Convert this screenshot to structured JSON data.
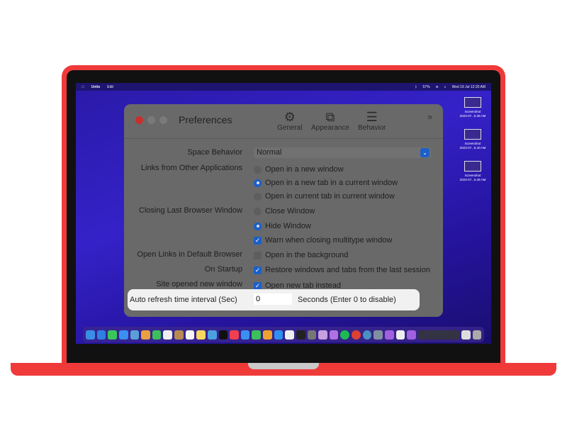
{
  "menubar": {
    "app": "Unite",
    "menu": "Edit",
    "battery": "57%",
    "datetime": "Wed 19 Jul 12:20 AM"
  },
  "desktop_icons": [
    {
      "line1": "Screenshot",
      "line2": "2023-07...5.38 AM"
    },
    {
      "line1": "Screenshot",
      "line2": "2023-07...5.40 AM"
    },
    {
      "line1": "Screenshot",
      "line2": "2023-07...5.45 AM"
    }
  ],
  "window": {
    "title": "Preferences",
    "toolbar": [
      {
        "label": "General",
        "icon": "gear-icon"
      },
      {
        "label": "Appearance",
        "icon": "appearance-icon"
      },
      {
        "label": "Behavior",
        "icon": "sliders-icon"
      }
    ],
    "space_behavior": {
      "label": "Space Behavior",
      "value": "Normal"
    },
    "links_other_apps": {
      "label": "Links from Other Applications",
      "options": [
        "Open in a new window",
        "Open in a new tab in a current window",
        "Open in current tab in current window"
      ],
      "selected": 1
    },
    "closing_last": {
      "label": "Closing Last Browser Window",
      "options": [
        "Close Window",
        "Hide Window"
      ],
      "selected": 1,
      "warn": {
        "label": "Warn when closing multitype window",
        "checked": true
      }
    },
    "open_default": {
      "label": "Open Links in Default Browser",
      "option": "Open in the background",
      "checked": false
    },
    "startup": {
      "label": "On Startup",
      "option": "Restore windows and tabs from the last session",
      "checked": true
    },
    "site_new_window": {
      "label": "Site opened new window",
      "option": "Open new tab instead",
      "checked": true
    },
    "auto_refresh": {
      "label": "Auto refresh time interval (Sec)",
      "value": "0",
      "suffix": "Seconds (Enter 0 to disable)"
    }
  },
  "colors": {
    "laptop": "#f03a3a",
    "accent": "#1c5fc8",
    "desktop": "#3422c8"
  }
}
